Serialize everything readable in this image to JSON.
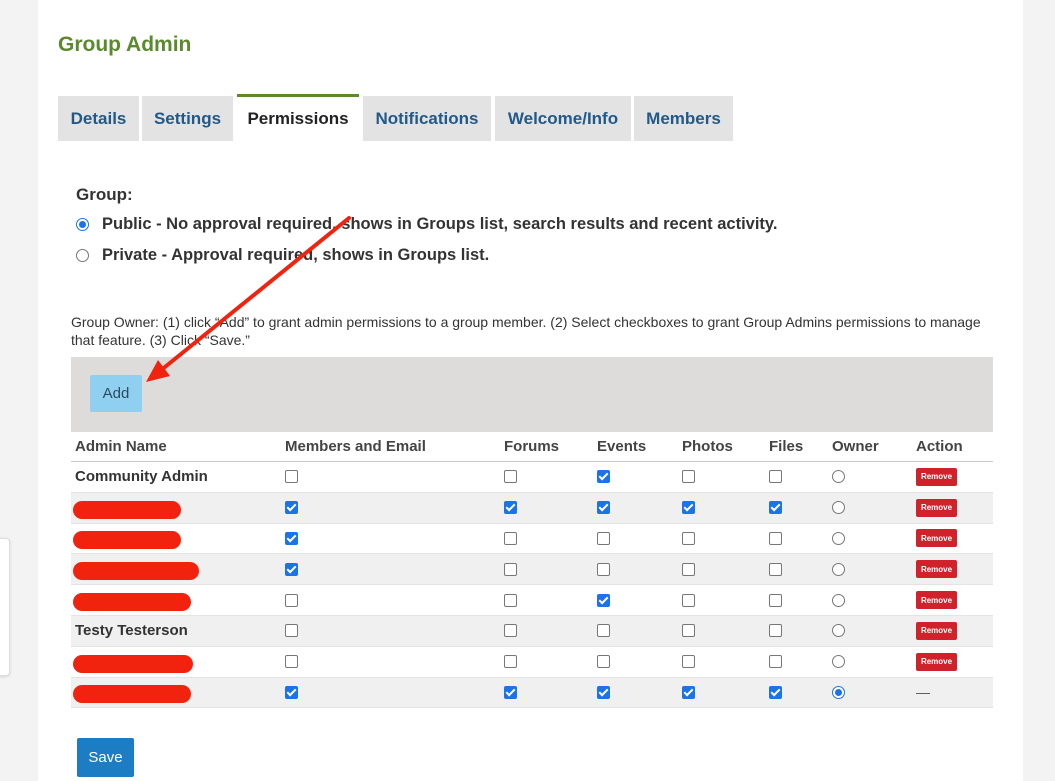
{
  "page_title": "Group Admin",
  "tabs": [
    {
      "label": "Details"
    },
    {
      "label": "Settings"
    },
    {
      "label": "Permissions"
    },
    {
      "label": "Notifications"
    },
    {
      "label": "Welcome/Info"
    },
    {
      "label": "Members"
    }
  ],
  "active_tab": "Permissions",
  "group": {
    "label": "Group:",
    "options": [
      {
        "label": "Public - No approval required, shows in Groups list, search results and recent activity.",
        "selected": true
      },
      {
        "label": "Private - Approval required, shows in Groups list.",
        "selected": false
      }
    ]
  },
  "instructions": "Group Owner: (1) click “Add” to grant admin permissions to a group member. (2) Select checkboxes to grant Group Admins permissions to manage that feature. (3) Click “Save.”",
  "toolbar": {
    "add_label": "Add"
  },
  "table": {
    "headers": [
      "Admin Name",
      "Members and Email",
      "Forums",
      "Events",
      "Photos",
      "Files",
      "Owner",
      "Action"
    ],
    "remove_label": "Remove",
    "owner_action": "—",
    "rows": [
      {
        "name": "Community Admin",
        "redacted": false,
        "members": false,
        "forums": false,
        "events": true,
        "photos": false,
        "files": false,
        "owner": false
      },
      {
        "name": "",
        "redacted": true,
        "members": true,
        "forums": true,
        "events": true,
        "photos": true,
        "files": true,
        "owner": false
      },
      {
        "name": "",
        "redacted": true,
        "members": true,
        "forums": false,
        "events": false,
        "photos": false,
        "files": false,
        "owner": false
      },
      {
        "name": "",
        "redacted": true,
        "members": true,
        "forums": false,
        "events": false,
        "photos": false,
        "files": false,
        "owner": false
      },
      {
        "name": "",
        "redacted": true,
        "members": false,
        "forums": false,
        "events": true,
        "photos": false,
        "files": false,
        "owner": false
      },
      {
        "name": "Testy Testerson",
        "redacted": false,
        "members": false,
        "forums": false,
        "events": false,
        "photos": false,
        "files": false,
        "owner": false
      },
      {
        "name": "",
        "redacted": true,
        "members": false,
        "forums": false,
        "events": false,
        "photos": false,
        "files": false,
        "owner": false
      },
      {
        "name": "",
        "redacted": true,
        "members": true,
        "forums": true,
        "events": true,
        "photos": true,
        "files": true,
        "owner": true
      }
    ]
  },
  "save_label": "Save",
  "colors": {
    "accent_green": "#5b8a2e",
    "tab_text": "#215a8a",
    "save": "#1c7cc4",
    "add": "#8fd0f1",
    "remove": "#d0222b",
    "annotation": "#f2230e"
  }
}
